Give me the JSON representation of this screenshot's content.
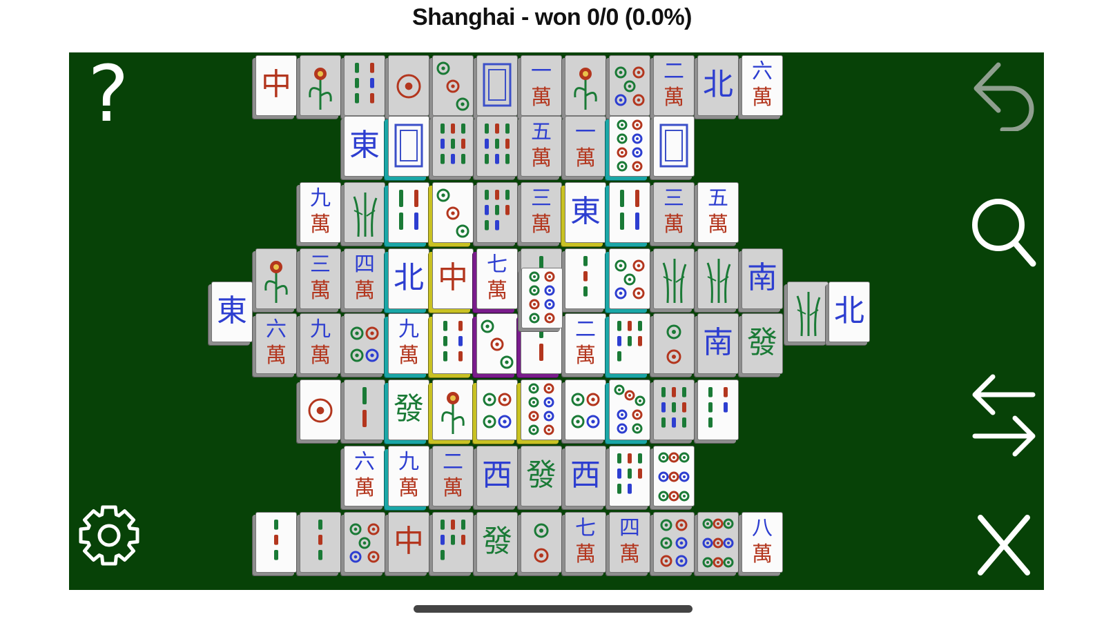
{
  "window": {
    "title": "Shanghai - won 0/0 (0.0%)"
  },
  "toolbar": {
    "help_label": "?",
    "help_icon": "question-mark-icon",
    "settings_icon": "gear-icon",
    "undo_icon": "undo-arrow-icon",
    "search_icon": "magnifier-icon",
    "shuffle_icon": "swap-arrows-icon",
    "close_icon": "close-x-icon"
  },
  "colors": {
    "table_felt": "#074207",
    "tile_face_free": "#fbfbfb",
    "tile_face_blocked": "#d2d2d2",
    "highlight_cyan": "#1aa7a7",
    "highlight_yellow": "#c9c223",
    "highlight_purple": "#7a1c8c",
    "character_red": "#b3361e",
    "wind_blue": "#2d3ed0",
    "bamboo_green": "#1a7a36"
  }
}
